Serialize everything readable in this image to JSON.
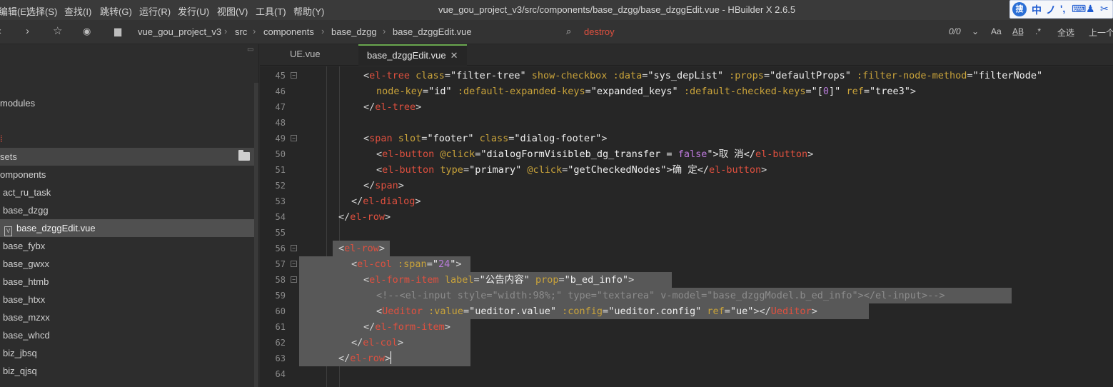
{
  "menubar": {
    "items": [
      {
        "label": "编辑(E)",
        "x_hint": "edit"
      },
      {
        "label": "选择(S)"
      },
      {
        "label": "查找(I)"
      },
      {
        "label": "跳转(G)"
      },
      {
        "label": "运行(R)"
      },
      {
        "label": "发行(U)"
      },
      {
        "label": "视图(V)"
      },
      {
        "label": "工具(T)"
      },
      {
        "label": "帮助(Y)"
      }
    ],
    "first_visible": "编辑(E)",
    "title": "vue_gou_project_v3/src/components/base_dzgg/base_dzggEdit.vue - HBuilder X 2.6.5",
    "ime": {
      "logo": "搜",
      "items": [
        "中",
        "ノ",
        "',",
        "⌨",
        "♟",
        "✂"
      ]
    }
  },
  "toolbar": {
    "breadcrumb": [
      "vue_gou_project_v3",
      "src",
      "components",
      "base_dzgg",
      "base_dzggEdit.vue"
    ],
    "search_value": "destroy",
    "match_count": "0/0",
    "case_label": "Aa",
    "word_label": "A̲B̲",
    "regex_label": ".*",
    "select_all_label": "全选",
    "prev_label": "上一个"
  },
  "sidebar": {
    "items": [
      {
        "label": "modules",
        "kind": "folder"
      },
      {
        "label": "",
        "kind": "marker"
      },
      {
        "label": "sets",
        "kind": "folder"
      },
      {
        "label": "omponents",
        "kind": "folder"
      },
      {
        "label": "act_ru_task",
        "kind": "folder"
      },
      {
        "label": "base_dzgg",
        "kind": "folder"
      },
      {
        "label": "base_dzggEdit.vue",
        "kind": "file"
      },
      {
        "label": "base_fybx",
        "kind": "folder"
      },
      {
        "label": "base_gwxx",
        "kind": "folder"
      },
      {
        "label": "base_htmb",
        "kind": "folder"
      },
      {
        "label": "base_htxx",
        "kind": "folder"
      },
      {
        "label": "base_mzxx",
        "kind": "folder"
      },
      {
        "label": "base_whcd",
        "kind": "folder"
      },
      {
        "label": "biz_jbsq",
        "kind": "folder"
      },
      {
        "label": "biz_qjsq",
        "kind": "folder"
      }
    ]
  },
  "tabs": [
    {
      "label": "UE.vue",
      "active": false
    },
    {
      "label": "base_dzggEdit.vue",
      "active": true
    }
  ],
  "editor": {
    "lines": [
      {
        "n": "45",
        "fold": true,
        "sel": false
      },
      {
        "n": "46",
        "fold": false,
        "sel": false
      },
      {
        "n": "47",
        "fold": false,
        "sel": false
      },
      {
        "n": "48",
        "fold": false,
        "sel": false
      },
      {
        "n": "49",
        "fold": true,
        "sel": false
      },
      {
        "n": "50",
        "fold": false,
        "sel": false
      },
      {
        "n": "51",
        "fold": false,
        "sel": false
      },
      {
        "n": "52",
        "fold": false,
        "sel": false
      },
      {
        "n": "53",
        "fold": false,
        "sel": false
      },
      {
        "n": "54",
        "fold": false,
        "sel": false
      },
      {
        "n": "55",
        "fold": false,
        "sel": false
      },
      {
        "n": "56",
        "fold": true,
        "sel": true
      },
      {
        "n": "57",
        "fold": true,
        "sel": true
      },
      {
        "n": "58",
        "fold": true,
        "sel": true
      },
      {
        "n": "59",
        "fold": false,
        "sel": true
      },
      {
        "n": "60",
        "fold": false,
        "sel": true
      },
      {
        "n": "61",
        "fold": false,
        "sel": true
      },
      {
        "n": "62",
        "fold": false,
        "sel": true
      },
      {
        "n": "63",
        "fold": false,
        "sel": true
      },
      {
        "n": "64",
        "fold": false,
        "sel": false
      }
    ],
    "code": {
      "l45": [
        "<",
        "el-tree",
        " class",
        "=",
        "\"filter-tree\"",
        " show-checkbox",
        " :data",
        "=",
        "\"sys_depList\"",
        " :props",
        "=",
        "\"defaultProps\"",
        " :filter-node-method",
        "=",
        "\"filterNode\""
      ],
      "l46": [
        "node-key",
        "=",
        "\"id\"",
        " :default-expanded-keys",
        "=",
        "\"expanded_keys\"",
        " :default-checked-keys",
        "=",
        "\"[",
        "0",
        "]\"",
        " ref",
        "=",
        "\"tree3\"",
        ">"
      ],
      "l47": [
        "</",
        "el-tree",
        ">"
      ],
      "l49": [
        "<",
        "span",
        " slot",
        "=",
        "\"footer\"",
        " class",
        "=",
        "\"dialog-footer\"",
        ">"
      ],
      "l50": [
        "<",
        "el-button",
        " @click",
        "=",
        "\"dialogFormVisibleb_dg_transfer = ",
        "false",
        "\"",
        ">取 消</",
        "el-button",
        ">"
      ],
      "l51": [
        "<",
        "el-button",
        " type",
        "=",
        "\"primary\"",
        " @click",
        "=",
        "\"getCheckedNodes\"",
        ">确 定</",
        "el-button",
        ">"
      ],
      "l52": [
        "</",
        "span",
        ">"
      ],
      "l53": [
        "</",
        "el-dialog",
        ">"
      ],
      "l54": [
        "</",
        "el-row",
        ">"
      ],
      "l56": [
        "<",
        "el-row",
        ">"
      ],
      "l57": [
        "<",
        "el-col",
        " :span",
        "=",
        "\"",
        "24",
        "\"",
        ">"
      ],
      "l58": [
        "<",
        "el-form-item",
        " label",
        "=",
        "\"公告内容\"",
        " prop",
        "=",
        "\"b_ed_info\"",
        ">"
      ],
      "l59": "<!--<el-input style=\"width:98%;\" type=\"textarea\" v-model=\"base_dzggModel.b_ed_info\"></el-input>-->",
      "l60": [
        "<",
        "Ueditor",
        " :value",
        "=",
        "\"ueditor.value\"",
        " :config",
        "=",
        "\"ueditor.config\"",
        " ref",
        "=",
        "\"ue\"",
        "></",
        "Ueditor",
        ">"
      ],
      "l61": [
        "</",
        "el-form-item",
        ">"
      ],
      "l62": [
        "</",
        "el-col",
        ">"
      ],
      "l63": [
        "</",
        "el-row",
        ">"
      ]
    }
  }
}
